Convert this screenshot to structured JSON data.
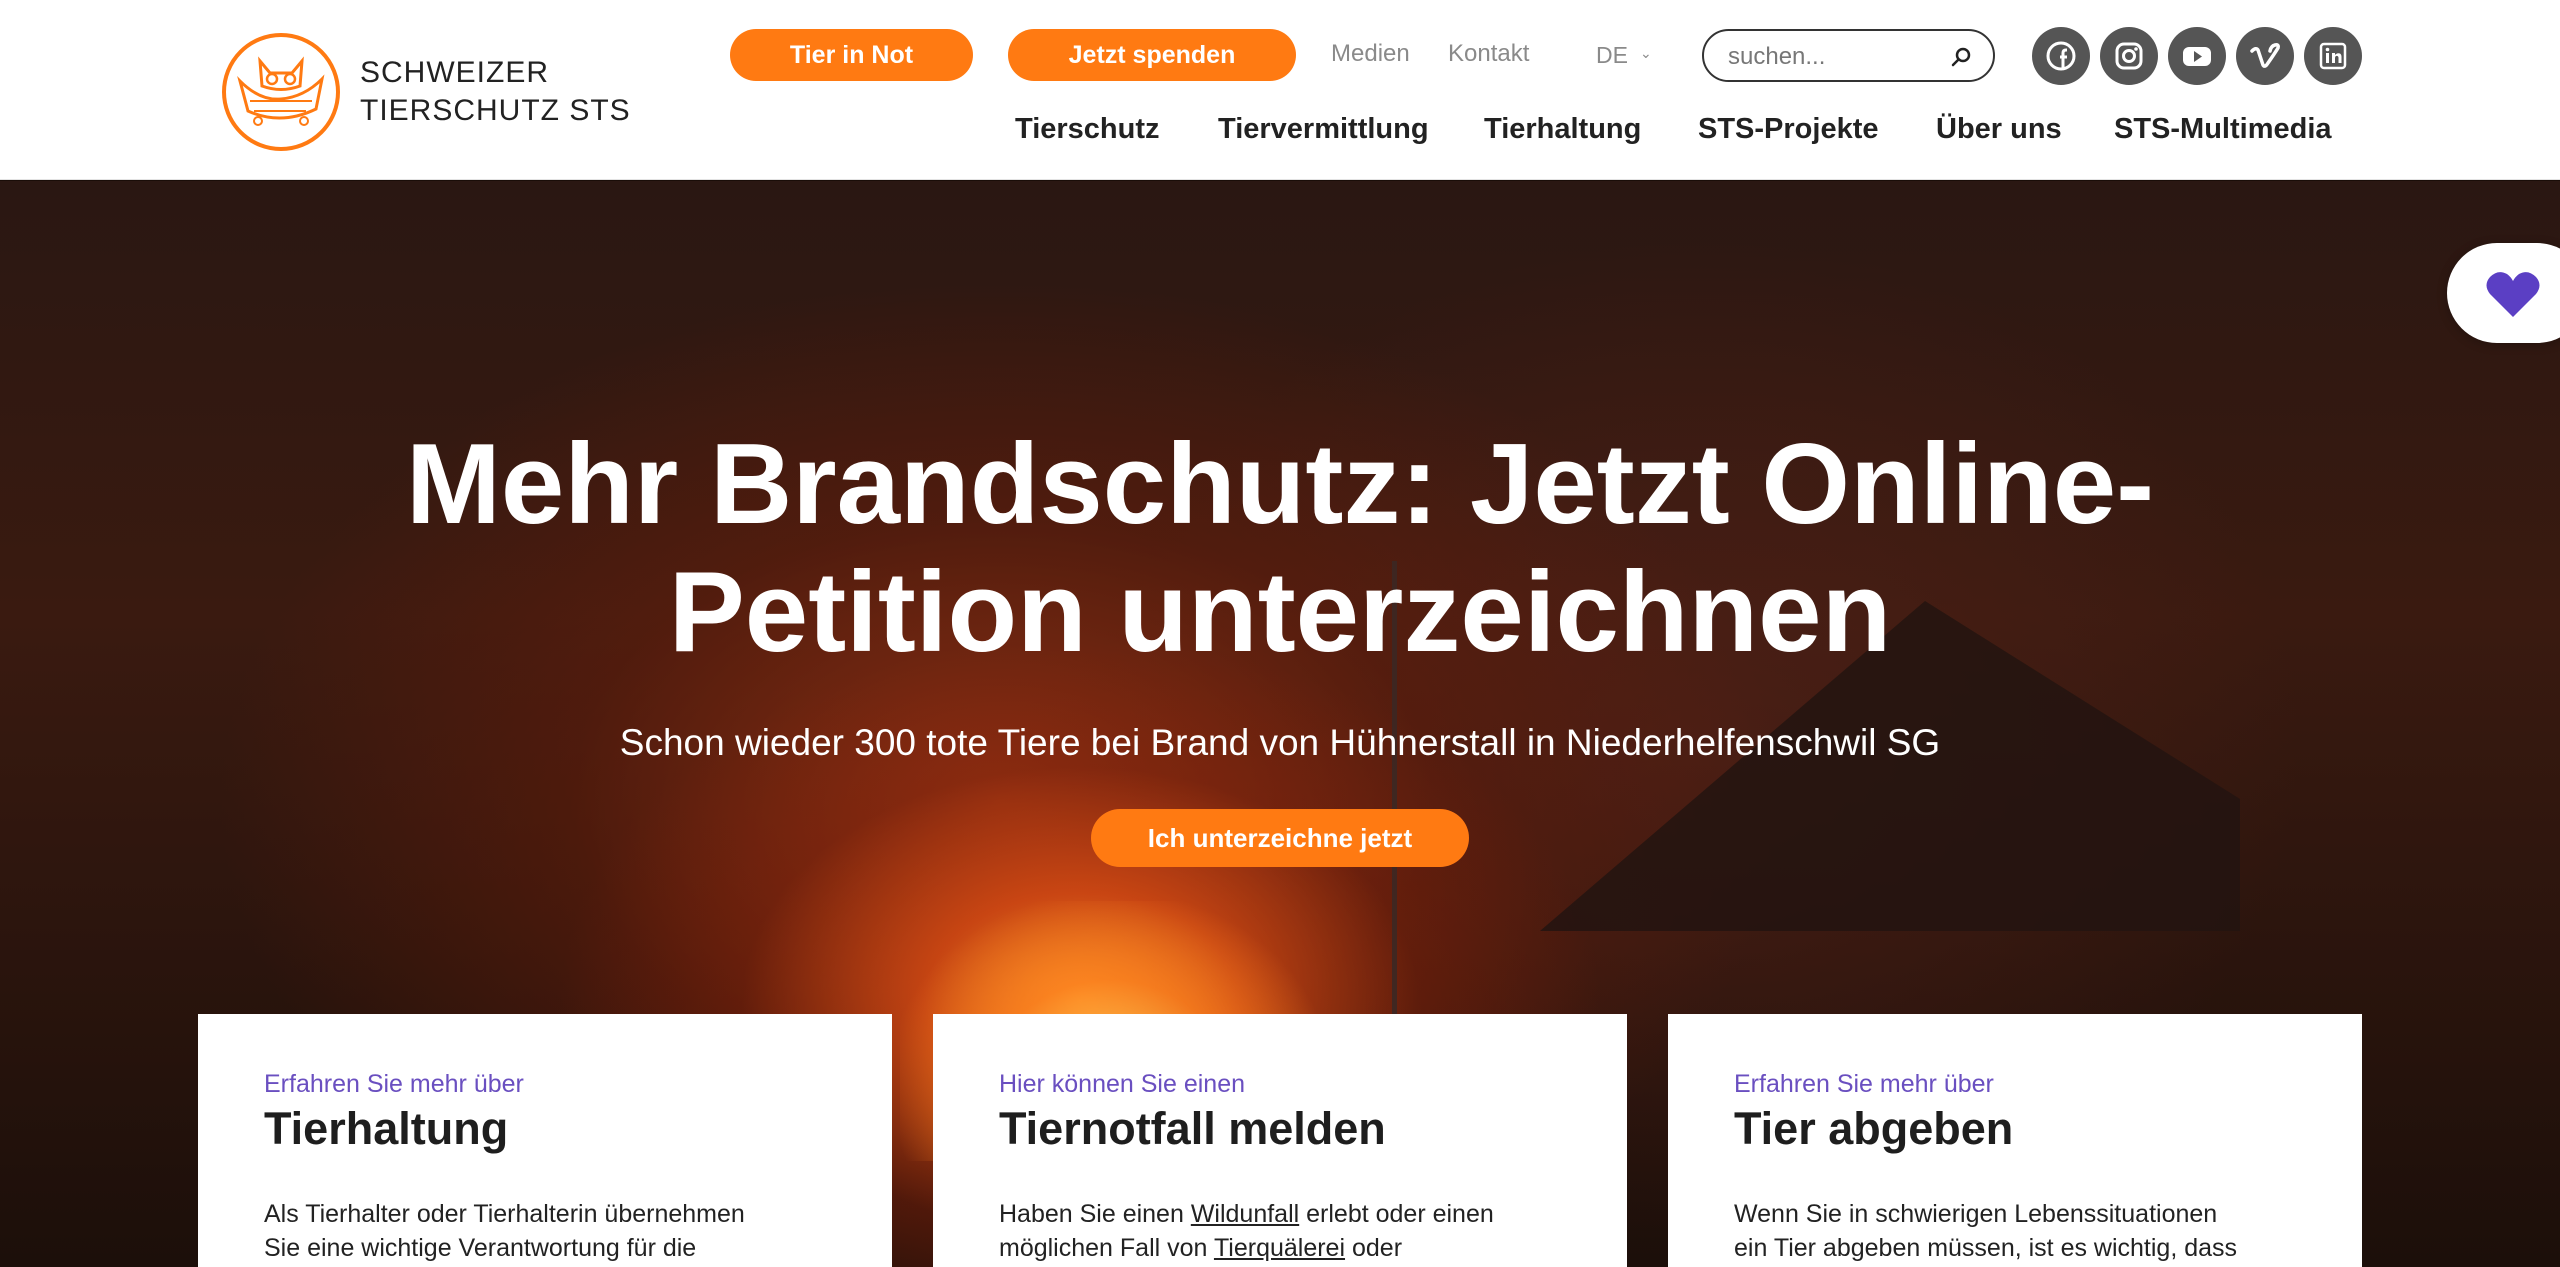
{
  "header": {
    "logo_line1": "SCHWEIZER",
    "logo_line2": "TIERSCHUTZ STS",
    "btn_tier_in_not": "Tier in Not",
    "btn_spenden": "Jetzt spenden",
    "link_medien": "Medien",
    "link_kontakt": "Kontakt",
    "language": "DE",
    "search_placeholder": "suchen...",
    "social": [
      "facebook-icon",
      "instagram-icon",
      "youtube-icon",
      "vimeo-icon",
      "linkedin-icon"
    ],
    "nav": [
      "Tierschutz",
      "Tiervermittlung",
      "Tierhaltung",
      "STS-Projekte",
      "Über uns",
      "STS-Multimedia"
    ]
  },
  "hero": {
    "title_line1": "Mehr Brandschutz: Jetzt Online-",
    "title_line2": "Petition unterzeichnen",
    "subtitle": "Schon wieder 300 tote Tiere bei Brand von Hühnerstall in Niederhelfenschwil SG",
    "cta": "Ich unterzeichne jetzt"
  },
  "cards": [
    {
      "kicker": "Erfahren Sie mehr über",
      "title": "Tierhaltung",
      "text_line1": "Als Tierhalter oder Tierhalterin übernehmen",
      "text_line2": "Sie eine wichtige Verantwortung für die"
    },
    {
      "kicker": "Hier können Sie einen",
      "title": "Tiernotfall melden",
      "text_line1_a": "Haben Sie einen ",
      "text_line1_link": "Wildunfall",
      "text_line1_b": " erlebt oder einen",
      "text_line2_a": "möglichen Fall von ",
      "text_line2_link": "Tierquälerei",
      "text_line2_b": " oder"
    },
    {
      "kicker": "Erfahren Sie mehr über",
      "title": "Tier abgeben",
      "text_line1": "Wenn Sie in schwierigen Lebenssituationen",
      "text_line2": "ein Tier abgeben müssen, ist es wichtig, dass"
    }
  ],
  "colors": {
    "accent_orange": "#ff7a12",
    "kicker_purple": "#6a4fc0",
    "heart_purple": "#5b3fc4",
    "social_grey": "#555555"
  }
}
